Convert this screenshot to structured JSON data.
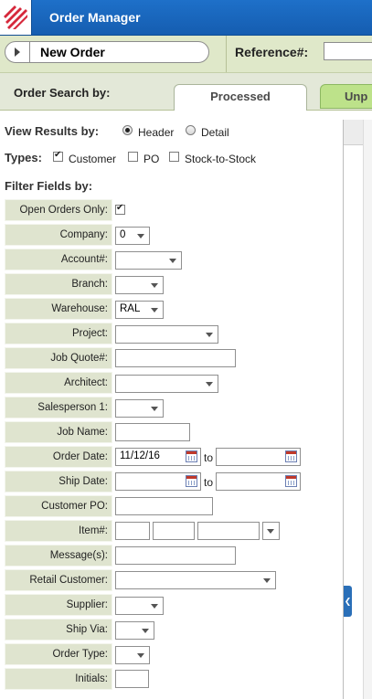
{
  "app": {
    "title": "Order Manager"
  },
  "toolbar": {
    "new_order_label": "New Order",
    "reference_label": "Reference#:",
    "reference_value": ""
  },
  "search": {
    "label": "Order Search by:",
    "tabs": [
      "Processed",
      "Unp"
    ]
  },
  "view_results": {
    "label": "View Results by:",
    "options": [
      "Header",
      "Detail"
    ],
    "selected": "Header"
  },
  "types": {
    "label": "Types:",
    "options": [
      "Customer",
      "PO",
      "Stock-to-Stock"
    ],
    "checked": [
      "Customer"
    ]
  },
  "filter": {
    "label": "Filter Fields by:",
    "open_orders_only": "Open Orders Only:",
    "company": {
      "label": "Company:",
      "value": "0"
    },
    "account": {
      "label": "Account#:",
      "value": ""
    },
    "branch": {
      "label": "Branch:",
      "value": ""
    },
    "warehouse": {
      "label": "Warehouse:",
      "value": "RAL"
    },
    "project": {
      "label": "Project:",
      "value": ""
    },
    "job_quote": {
      "label": "Job Quote#:",
      "value": ""
    },
    "architect": {
      "label": "Architect:",
      "value": ""
    },
    "salesperson": {
      "label": "Salesperson 1:",
      "value": ""
    },
    "job_name": {
      "label": "Job Name:",
      "value": ""
    },
    "order_date": {
      "label": "Order Date:",
      "from": "11/12/16",
      "to": ""
    },
    "ship_date": {
      "label": "Ship Date:",
      "from": "",
      "to": ""
    },
    "to_label": "to",
    "customer_po": {
      "label": "Customer PO:",
      "value": ""
    },
    "item": {
      "label": "Item#:"
    },
    "messages": {
      "label": "Message(s):",
      "value": ""
    },
    "retail_customer": {
      "label": "Retail Customer:",
      "value": ""
    },
    "supplier": {
      "label": "Supplier:",
      "value": ""
    },
    "ship_via": {
      "label": "Ship Via:",
      "value": ""
    },
    "order_type": {
      "label": "Order Type:",
      "value": ""
    },
    "initials": {
      "label": "Initials:",
      "value": ""
    }
  }
}
